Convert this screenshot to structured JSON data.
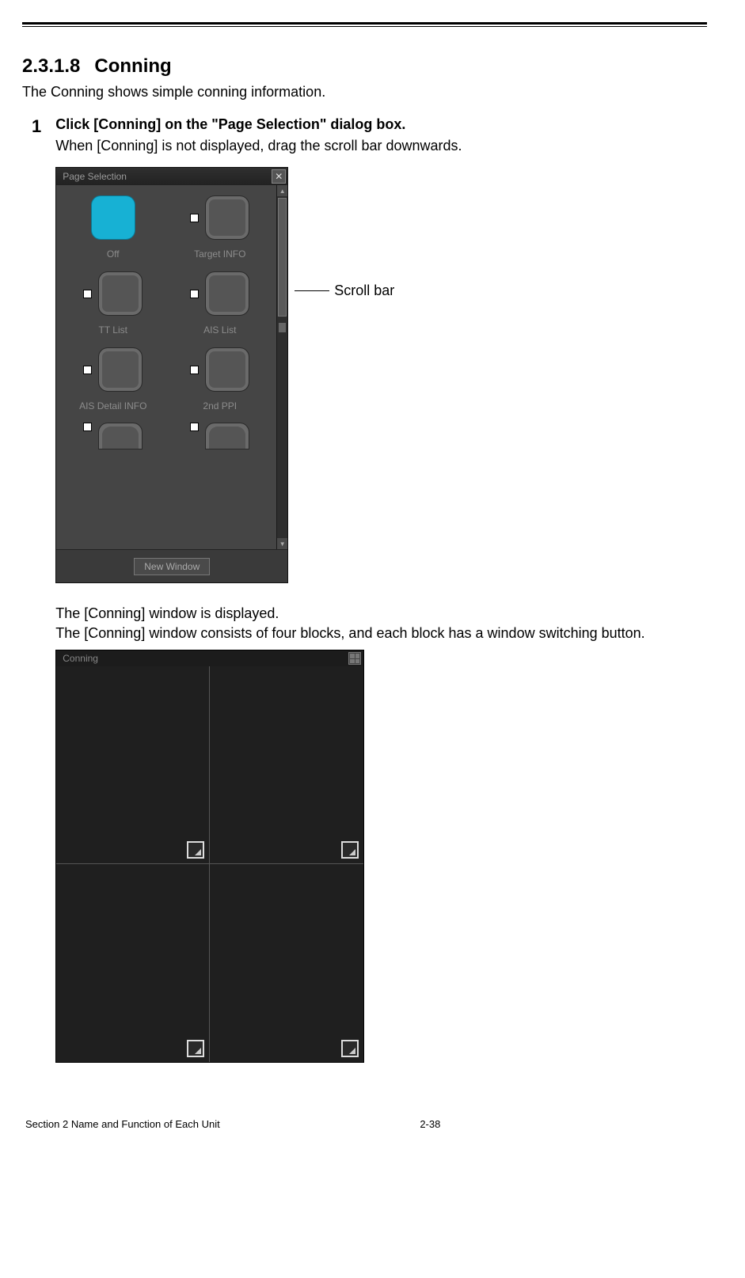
{
  "heading": {
    "number": "2.3.1.8",
    "title": "Conning"
  },
  "lead": "The Conning shows simple conning information.",
  "step": {
    "num": "1",
    "title": "Click [Conning] on the \"Page Selection\" dialog box.",
    "note": "When [Conning] is not displayed, drag the scroll bar downwards."
  },
  "page_selection": {
    "title": "Page Selection",
    "close_glyph": "✕",
    "items": [
      {
        "label": "Off",
        "thumb": "off"
      },
      {
        "label": "Target INFO",
        "thumb": "std",
        "radio": true
      },
      {
        "label": "TT List",
        "thumb": "std",
        "radio": true
      },
      {
        "label": "AIS List",
        "thumb": "std",
        "radio": true
      },
      {
        "label": "AIS Detail INFO",
        "thumb": "std",
        "radio": true
      },
      {
        "label": "2nd PPI",
        "thumb": "std",
        "radio": true
      },
      {
        "label": "",
        "thumb": "cut",
        "radio": true
      },
      {
        "label": "",
        "thumb": "cut",
        "radio": true
      }
    ],
    "new_window": "New Window",
    "scroll_up_glyph": "▲",
    "scroll_down_glyph": "▼"
  },
  "scrollbar_label": "Scroll bar",
  "after_text1": "The [Conning] window is displayed.",
  "after_text2": "The [Conning] window consists of four blocks, and each block has a window switching button.",
  "conning_window": {
    "title": "Conning"
  },
  "footer": {
    "section": "Section 2    Name and Function of Each Unit",
    "page": "2-38"
  }
}
